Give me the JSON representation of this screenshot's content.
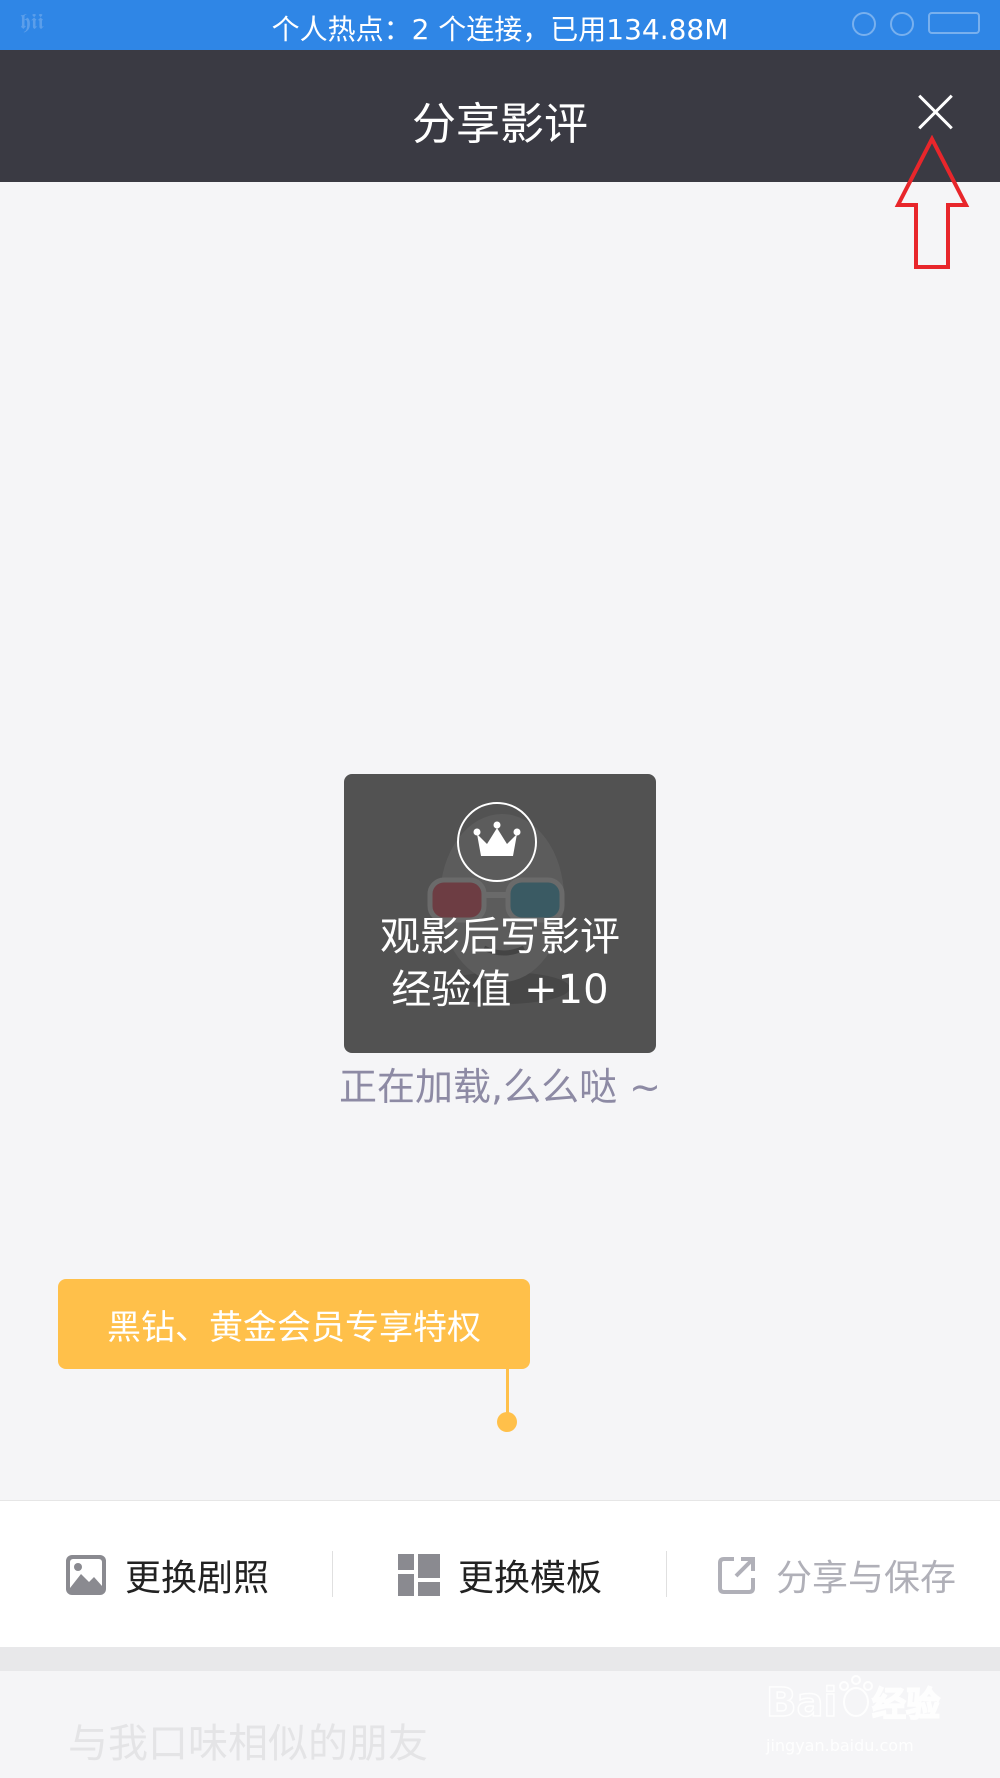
{
  "status_bar": {
    "left_text": "𝖍𝖎𝖎",
    "center_text": "个人热点：2 个连接，已用134.88M"
  },
  "nav": {
    "title": "分享影评",
    "close_icon": "close-icon"
  },
  "loading_card": {
    "line1": "观影后写影评",
    "line2": "经验值 +10",
    "icon": "crown-icon"
  },
  "loading_text": "正在加载,么么哒 ~",
  "vip_tag": "黑钻、黄金会员专享特权",
  "toolbar": {
    "items": [
      {
        "label": "更换剧照",
        "icon": "image-icon"
      },
      {
        "label": "更换模板",
        "icon": "grid-icon"
      },
      {
        "label": "分享与保存",
        "icon": "share-icon"
      }
    ]
  },
  "section_title": "与我口味相似的朋友",
  "watermark": {
    "logo": "Bai du 经验",
    "url": "jingyan.baidu.com"
  },
  "colors": {
    "status_bar": "#2f86e6",
    "nav_bar": "#3a3a43",
    "accent_orange": "#ffc04a",
    "annotation_red": "#e8262b"
  }
}
